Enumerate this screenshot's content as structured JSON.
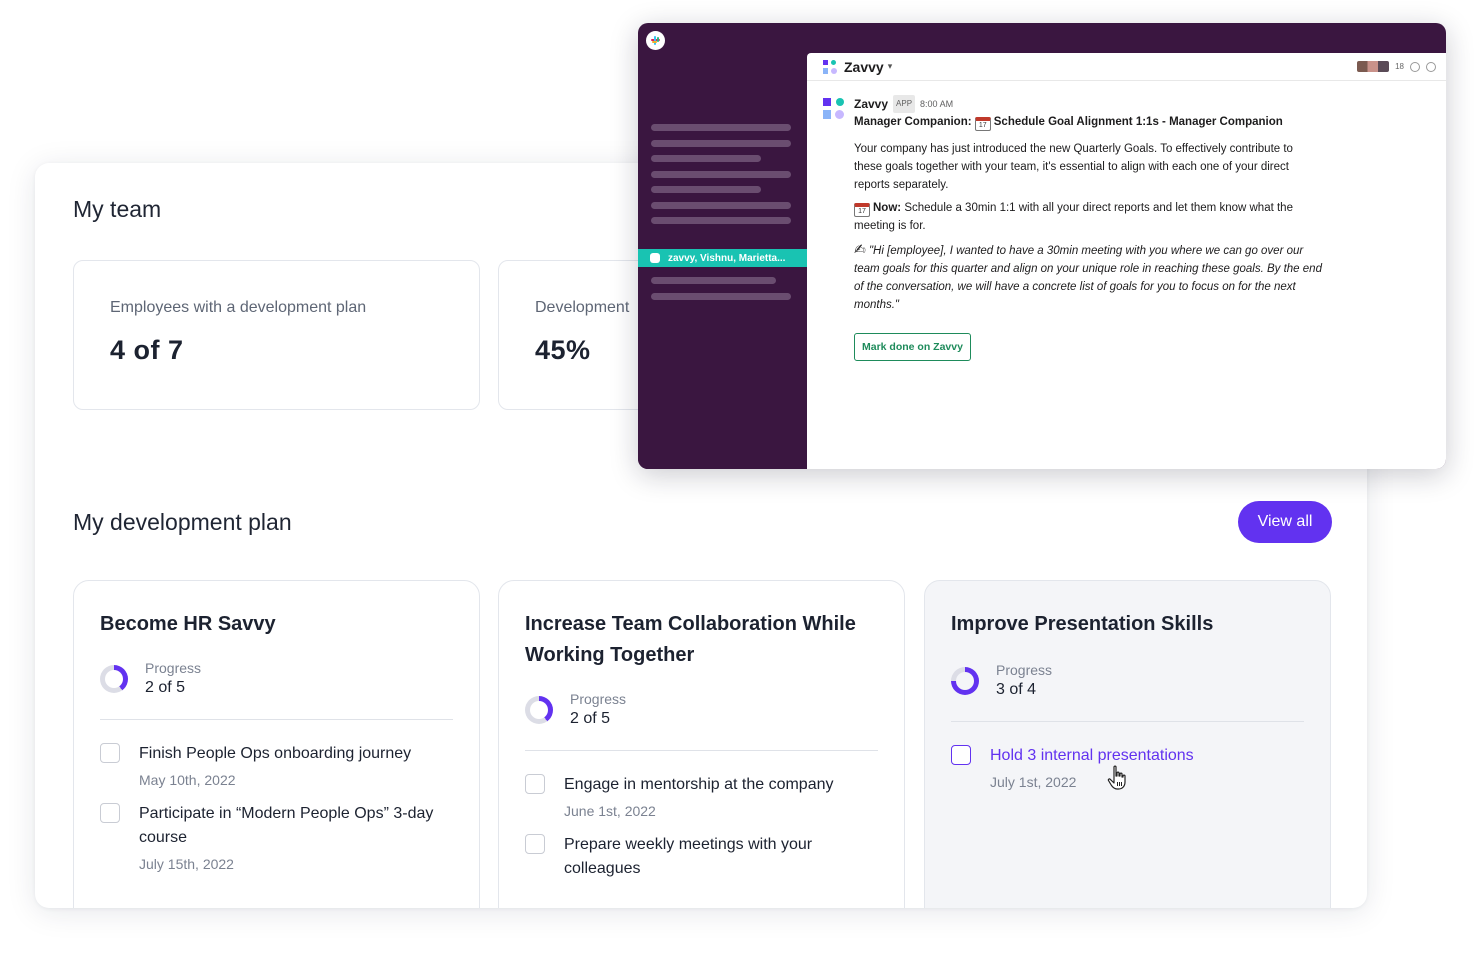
{
  "my_team": {
    "title": "My team",
    "stats": [
      {
        "label": "Employees with a development plan",
        "value": "4 of 7"
      },
      {
        "label": "Development",
        "value": "45%"
      }
    ]
  },
  "dev_plan": {
    "title": "My development plan",
    "view_all_label": "View all",
    "plans": [
      {
        "title": "Become HR Savvy",
        "progress_label": "Progress",
        "progress_value": "2 of 5",
        "progress_fraction": 0.4,
        "tasks": [
          {
            "name": "Finish People Ops onboarding journey",
            "date": "May 10th, 2022"
          },
          {
            "name": "Participate in “Modern People Ops” 3-day course",
            "date": "July 15th, 2022"
          }
        ]
      },
      {
        "title": "Increase Team Collaboration While Working Together",
        "progress_label": "Progress",
        "progress_value": "2 of 5",
        "progress_fraction": 0.4,
        "tasks": [
          {
            "name": "Engage in mentorship at the company",
            "date": "June 1st, 2022"
          },
          {
            "name": "Prepare weekly meetings with your colleagues",
            "date": ""
          }
        ]
      },
      {
        "title": "Improve Presentation Skills",
        "progress_label": "Progress",
        "progress_value": "3 of 4",
        "progress_fraction": 0.75,
        "tasks": [
          {
            "name": "Hold 3 internal presentations",
            "date": "July 1st, 2022"
          }
        ]
      }
    ]
  },
  "slack": {
    "channel_label": "zavvy, Vishnu, Marietta...",
    "header_name": "Zavvy",
    "member_count": "18",
    "message": {
      "bot_name": "Zavvy",
      "badge": "APP",
      "time": "8:00 AM",
      "heading_prefix": "Manager Companion:",
      "heading_title": "Schedule Goal Alignment 1:1s - Manager Companion",
      "paragraph": "Your company has just introduced the new Quarterly Goals. To effectively contribute to these goals together with your team, it's essential to align with each one of your direct reports separately.",
      "now_label": "Now:",
      "now_text": "Schedule a 30min 1:1 with all your direct reports and let them know what the meeting is for.",
      "quote": "\"Hi [employee], I wanted to have a 30min meeting with you where we can go over our team goals for this quarter and align on your unique role in reaching these goals. By the end of the conversation, we will have a concrete list of goals for you to focus on for the next months.\"",
      "button_label": "Mark done on Zavvy"
    }
  },
  "colors": {
    "accent": "#6232f0",
    "slack_sidebar": "#3a1640",
    "slack_active": "#19c3b2",
    "slack_button": "#1e8b5b"
  }
}
